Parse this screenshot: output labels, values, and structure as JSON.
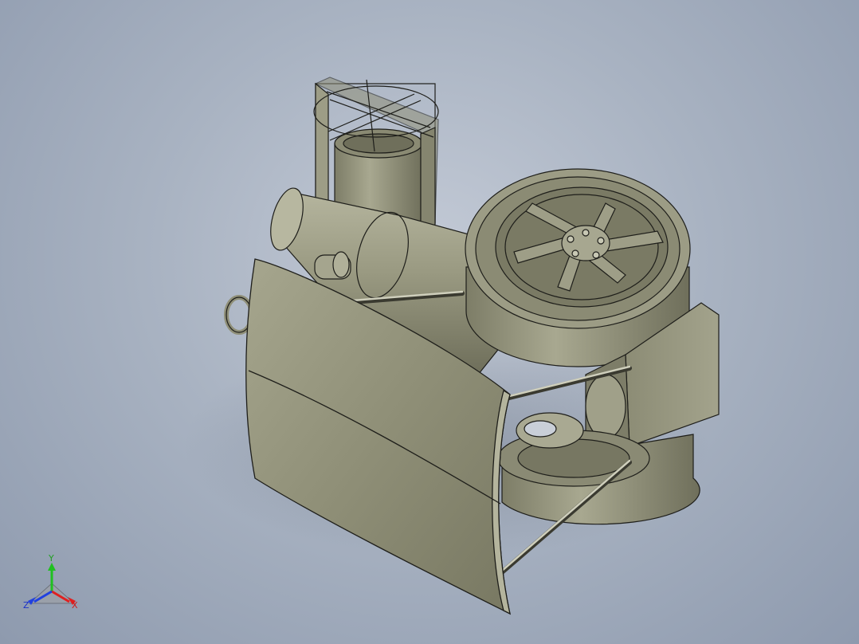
{
  "viewport": {
    "background_top": "#c3cad6",
    "background_bottom": "#8e9aae"
  },
  "model": {
    "part_color": "#9a9a82",
    "part_shadow": "#6f705e",
    "edge_color": "#1e1e1a"
  },
  "triad": {
    "x_label": "X",
    "y_label": "Y",
    "z_label": "Z",
    "x_color": "#e02020",
    "y_color": "#20c020",
    "z_color": "#2040e0"
  }
}
